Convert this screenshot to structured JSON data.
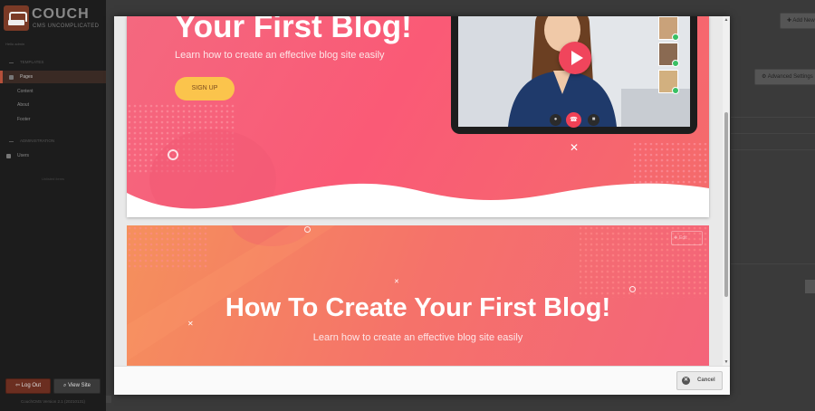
{
  "sidebar": {
    "logo_name": "COUCH",
    "logo_tagline": "CMS UNCOMPLICATED",
    "user_line": "Hello admin",
    "section_templates": "TEMPLATES",
    "section_administration": "ADMINISTRATION",
    "items": [
      {
        "label": "Pages"
      },
      {
        "label": "Content"
      },
      {
        "label": "About"
      },
      {
        "label": "Footer"
      },
      {
        "label": "Users"
      }
    ],
    "extra_note": "Unlisted items",
    "logout_label": "Log Out",
    "view_site_label": "View Site",
    "version": "CouchCMS Version 2.1 (20210131)"
  },
  "background": {
    "add_new_label": "Add New",
    "advanced_settings_label": "Advanced Settings"
  },
  "modal": {
    "cancel_label": "Cancel",
    "hero1": {
      "title": "Your First Blog!",
      "subtitle": "Learn how to create an effective blog site easily",
      "cta": "SIGN UP"
    },
    "hero2": {
      "edit_label": "Edit",
      "title": "How To Create Your First Blog!",
      "subtitle": "Learn how to create an effective blog site easily"
    }
  },
  "colors": {
    "sidebar_bg": "#1c1c1c",
    "accent": "#b5503a",
    "hero1_gradient": "#fa5a76",
    "hero2_gradient": "#f5726a",
    "cta": "#fbc44c",
    "play_button": "#f0455c"
  },
  "icons": [
    "couch-logo-icon",
    "pages-icon",
    "users-icon",
    "logout-icon",
    "view-site-icon",
    "plus-icon",
    "gear-icon",
    "close-icon",
    "play-icon",
    "mic-icon",
    "end-call-icon",
    "camera-icon",
    "scroll-up-icon",
    "scroll-down-icon"
  ]
}
